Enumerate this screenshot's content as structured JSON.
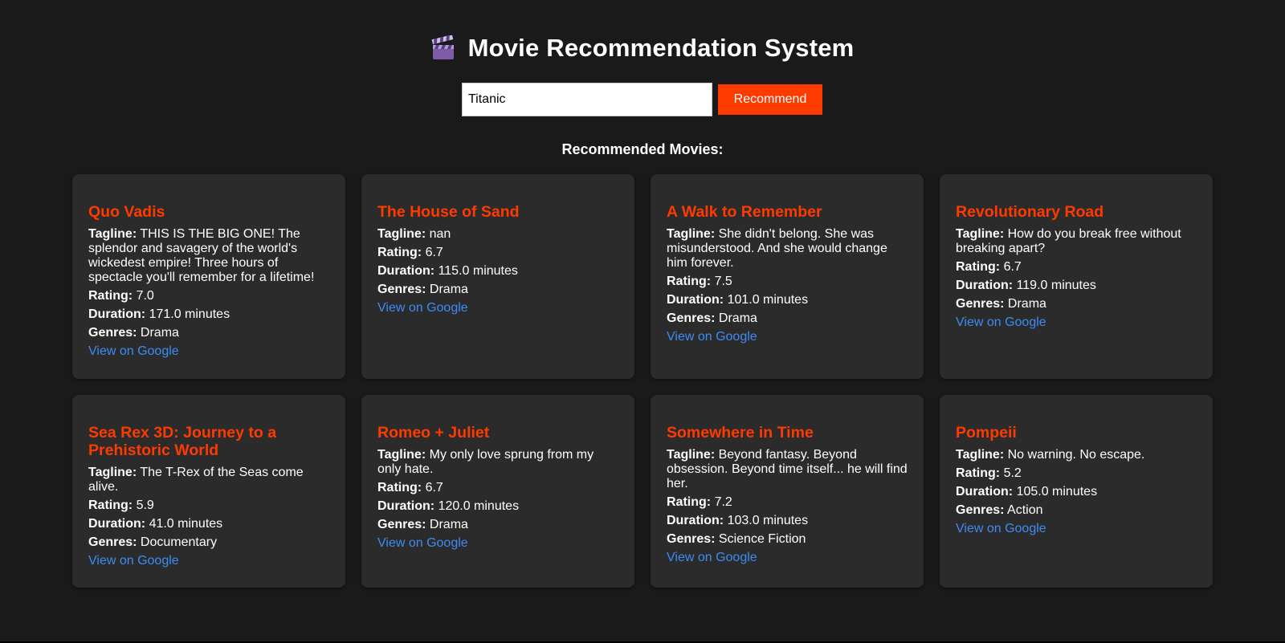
{
  "header": {
    "icon": "clapperboard-icon",
    "title": "Movie Recommendation System"
  },
  "search": {
    "value": "Titanic",
    "button_label": "Recommend"
  },
  "results": {
    "heading": "Recommended Movies:",
    "labels": {
      "tagline": "Tagline:",
      "rating": "Rating:",
      "duration": "Duration:",
      "genres": "Genres:"
    },
    "link_label": "View on Google",
    "movies": [
      {
        "title": "Quo Vadis",
        "tagline": "THIS IS THE BIG ONE! The splendor and savagery of the world's wickedest empire! Three hours of spectacle you'll remember for a lifetime!",
        "rating": "7.0",
        "duration": "171.0 minutes",
        "genres": "Drama"
      },
      {
        "title": "The House of Sand",
        "tagline": "nan",
        "rating": "6.7",
        "duration": "115.0 minutes",
        "genres": "Drama"
      },
      {
        "title": "A Walk to Remember",
        "tagline": "She didn't belong. She was misunderstood. And she would change him forever.",
        "rating": "7.5",
        "duration": "101.0 minutes",
        "genres": "Drama"
      },
      {
        "title": "Revolutionary Road",
        "tagline": "How do you break free without breaking apart?",
        "rating": "6.7",
        "duration": "119.0 minutes",
        "genres": "Drama"
      },
      {
        "title": "Sea Rex 3D: Journey to a Prehistoric World",
        "tagline": "The T-Rex of the Seas come alive.",
        "rating": "5.9",
        "duration": "41.0 minutes",
        "genres": "Documentary"
      },
      {
        "title": "Romeo + Juliet",
        "tagline": "My only love sprung from my only hate.",
        "rating": "6.7",
        "duration": "120.0 minutes",
        "genres": "Drama"
      },
      {
        "title": "Somewhere in Time",
        "tagline": "Beyond fantasy. Beyond obsession. Beyond time itself... he will find her.",
        "rating": "7.2",
        "duration": "103.0 minutes",
        "genres": "Science Fiction"
      },
      {
        "title": "Pompeii",
        "tagline": "No warning. No escape.",
        "rating": "5.2",
        "duration": "105.0 minutes",
        "genres": "Action"
      }
    ]
  },
  "colors": {
    "background": "#1a1a1a",
    "card": "#2b2b2b",
    "accent": "#ff3a00",
    "link": "#3d8cf5"
  }
}
